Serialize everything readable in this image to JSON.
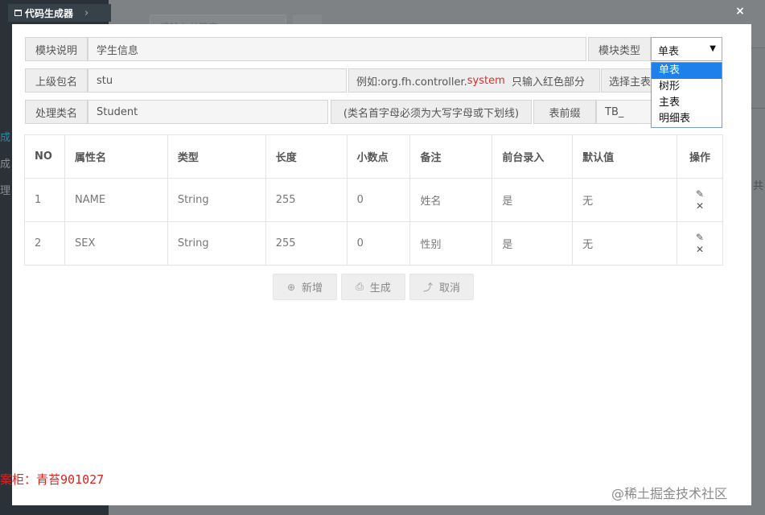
{
  "background": {
    "search_placeholder": "请输入关键字",
    "sidebar_chars": [
      "成",
      "成",
      "理"
    ],
    "right_text": "共"
  },
  "dialog": {
    "title": "代码生成器",
    "title_chevron": "›",
    "close_label": "×"
  },
  "form": {
    "module_desc_label": "模块说明",
    "module_desc_value": "学生信息",
    "module_type_label": "模块类型",
    "module_type_selected": "单表",
    "module_type_options": [
      "单表",
      "树形",
      "主表",
      "明细表"
    ],
    "parent_pkg_label": "上级包名",
    "parent_pkg_value": "stu",
    "pkg_hint_prefix": "例如:org.fh.controller.",
    "pkg_hint_red": "system",
    "pkg_hint_suffix": "只输入红色部分",
    "select_main_label": "选择主表",
    "class_name_label": "处理类名",
    "class_name_value": "Student",
    "class_hint": "(类名首字母必须为大写字母或下划线)",
    "table_prefix_label": "表前缀",
    "table_prefix_value": "TB_"
  },
  "table": {
    "headers": [
      "NO",
      "属性名",
      "类型",
      "长度",
      "小数点",
      "备注",
      "前台录入",
      "默认值",
      "操作"
    ],
    "rows": [
      [
        "1",
        "NAME",
        "String",
        "255",
        "0",
        "姓名",
        "是",
        "无"
      ],
      [
        "2",
        "SEX",
        "String",
        "255",
        "0",
        "性别",
        "是",
        "无"
      ]
    ]
  },
  "buttons": {
    "add": "新增",
    "generate": "生成",
    "cancel": "取消"
  },
  "watermarks": {
    "left": "案柜：青苔901027",
    "right": "@稀土掘金技术社区"
  }
}
